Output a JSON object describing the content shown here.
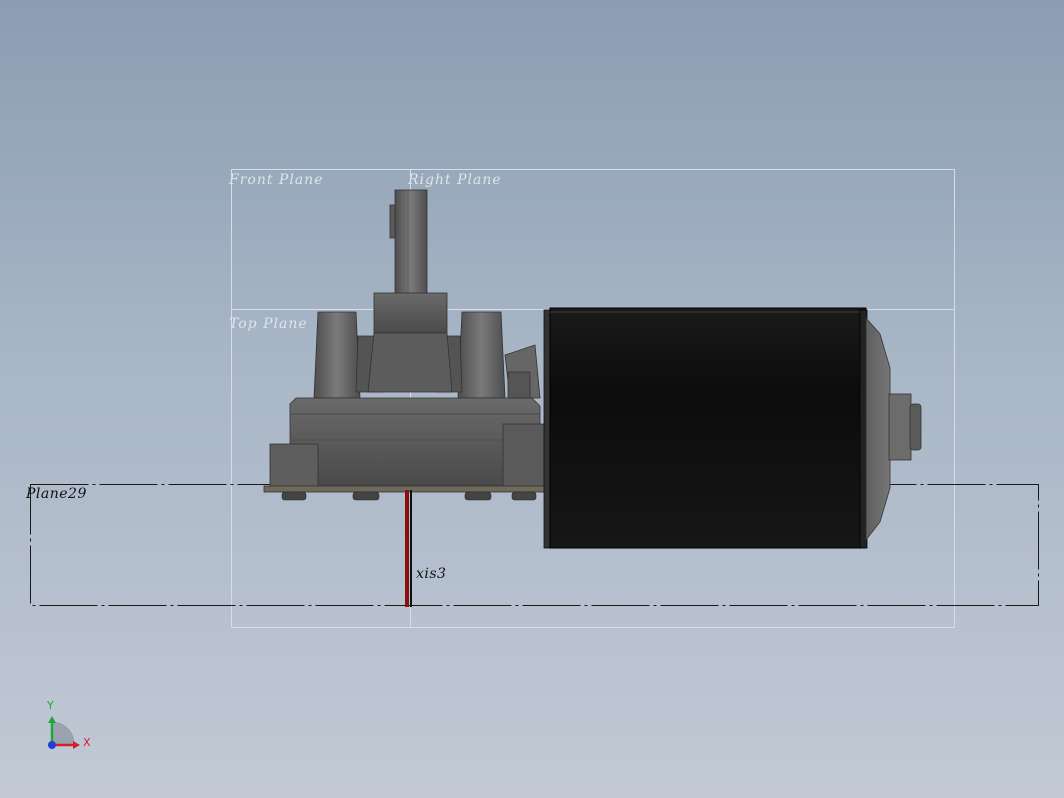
{
  "planes": {
    "front": "Front Plane",
    "right": "Right Plane",
    "top": "Top Plane",
    "plane29": "Plane29"
  },
  "axis_label": "xis3",
  "triad": {
    "x": "X",
    "y": "Y"
  },
  "colors": {
    "background_top": "#8a9db2",
    "background_bottom": "#c2c9d5",
    "motor_body": "#111111",
    "gearbox": "#5a5a5a",
    "axis": "#8a1010",
    "triad_x": "#d0202a",
    "triad_y": "#1ea838",
    "triad_z": "#1f3fd0"
  }
}
